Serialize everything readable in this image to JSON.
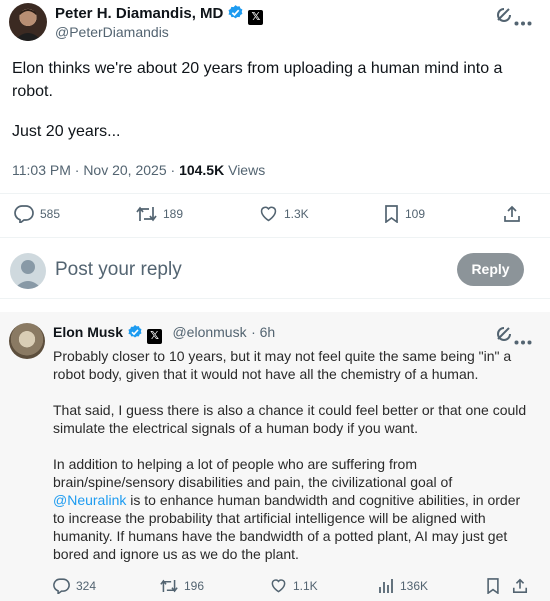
{
  "post": {
    "author_name": "Peter H. Diamandis, MD",
    "author_handle": "@PeterDiamandis",
    "text_line1": "Elon thinks we're about 20 years from uploading a human mind into a",
    "text_line2": "robot.",
    "text_line3": "Just 20 years...",
    "time": "11:03 PM · Nov 20, 2025 · ",
    "views_count": "104.5K",
    "views_label": "Views",
    "stats": {
      "replies": "585",
      "reposts": "189",
      "likes": "1.3K",
      "bookmarks": "109"
    }
  },
  "compose": {
    "placeholder": "Post your reply",
    "button_label": "Reply"
  },
  "reply": {
    "author_name": "Elon Musk",
    "author_handle": "@elonmusk",
    "age": "· 6h",
    "para1_line1": "Probably closer to 10 years, but it may not feel quite the same being \"in\" a",
    "para1_line2": "robot body, given that it would not have all the chemistry of a human.",
    "para2_line1": "That said, I guess there is also a chance it could feel better or that one could",
    "para2_line2": "simulate the electrical signals of a human body if you want.",
    "para3_line1": "In addition to helping a lot of people who are suffering from",
    "para3_line2": "brain/spine/sensory disabilities and pain, the civilizational goal of",
    "para3_link": "@Neuralink",
    "para3_line3_rest": " is to enhance human bandwidth and cognitive abilities, in order",
    "para3_line4": "to increase the probability that artificial intelligence will be aligned with",
    "para3_line5": "humanity. If humans have the bandwidth of a potted plant, AI may just get",
    "para3_line6": "bored and ignore us as we do the plant.",
    "stats": {
      "replies": "324",
      "reposts": "196",
      "likes": "1.1K",
      "views": "136K"
    }
  },
  "colors": {
    "verified": "#1d9bf0",
    "link": "#1d9bf0",
    "reply_button": "#8c9499"
  }
}
